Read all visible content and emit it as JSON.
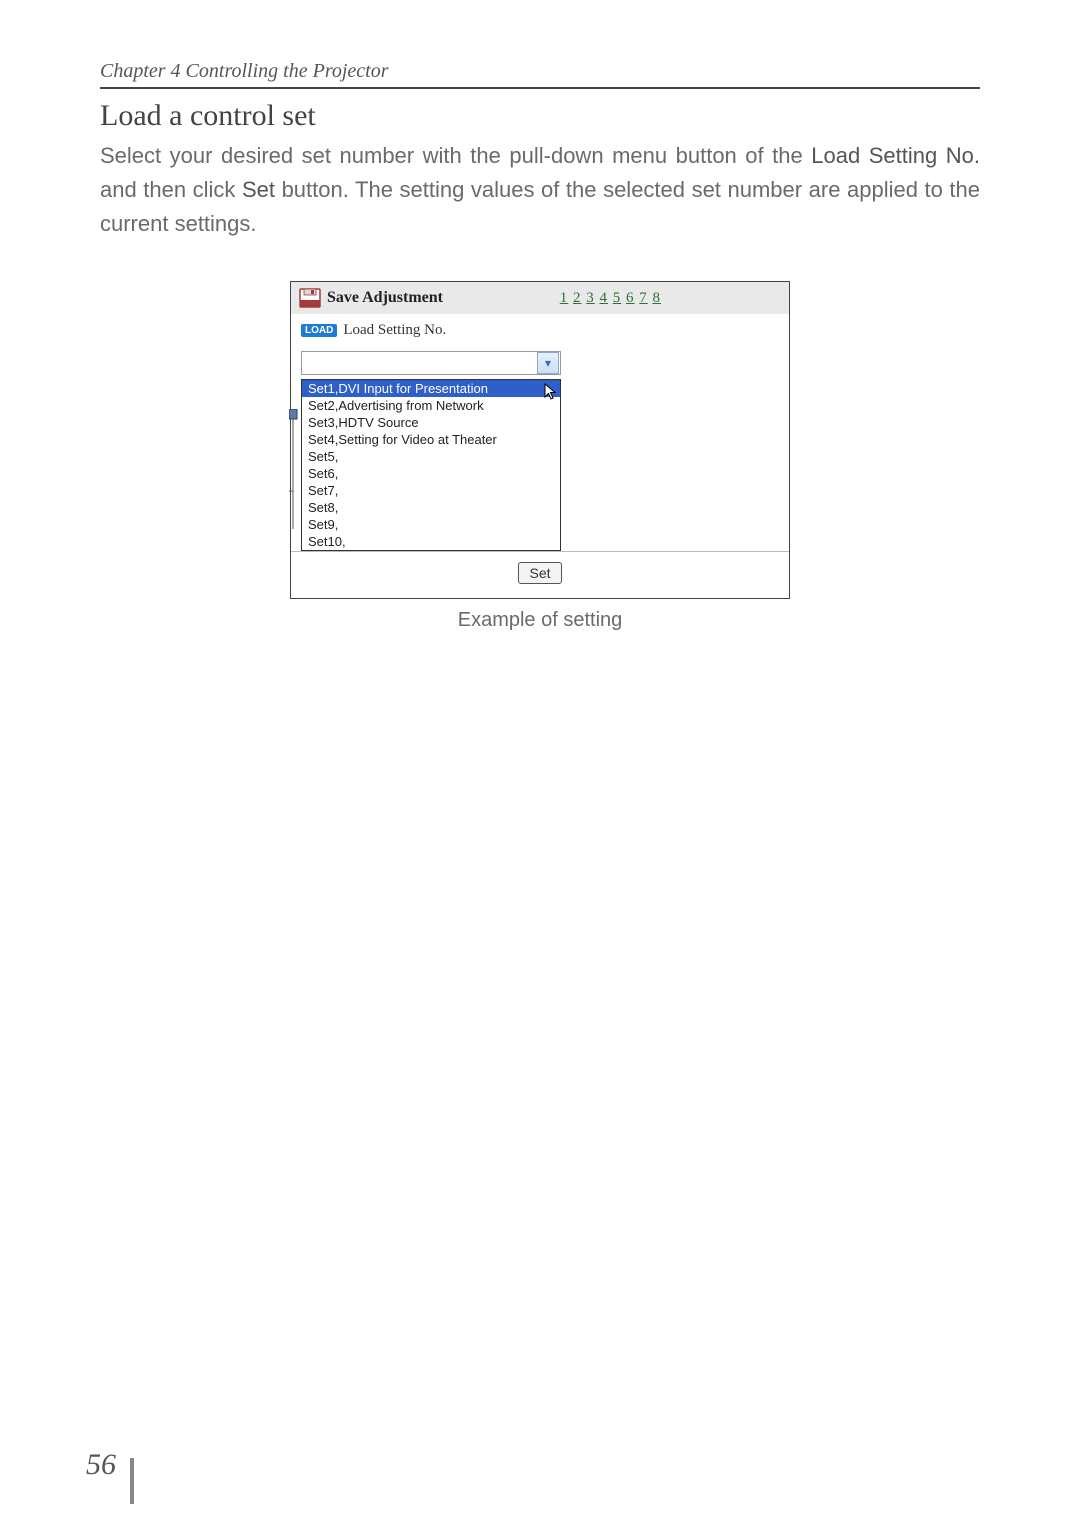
{
  "header": {
    "chapter": "Chapter 4 Controlling the Projector"
  },
  "section": {
    "title": "Load a control set",
    "body_pre": "Select your desired set number with the pull-down menu button of the ",
    "kw1": "Load Setting No.",
    "body_mid": " and then click ",
    "kw2": "Set",
    "body_post": " button. The setting values of the selected set number are applied to the current settings."
  },
  "figure": {
    "header_title": "Save Adjustment",
    "page_links": [
      "1",
      "2",
      "3",
      "4",
      "5",
      "6",
      "7",
      "8"
    ],
    "load_badge": "LOAD",
    "sub_label": "Load Setting No.",
    "dropdown_arrow": "▾",
    "dropdown_items": [
      "Set1,DVI Input for Presentation",
      "Set2,Advertising from Network",
      "Set3,HDTV Source",
      "Set4,Setting for Video at Theater",
      "Set5,",
      "Set6,",
      "Set7,",
      "Set8,",
      "Set9,",
      "Set10,"
    ],
    "selected_index": 0,
    "set_button": "Set",
    "caption": "Example of setting"
  },
  "page_number": "56"
}
